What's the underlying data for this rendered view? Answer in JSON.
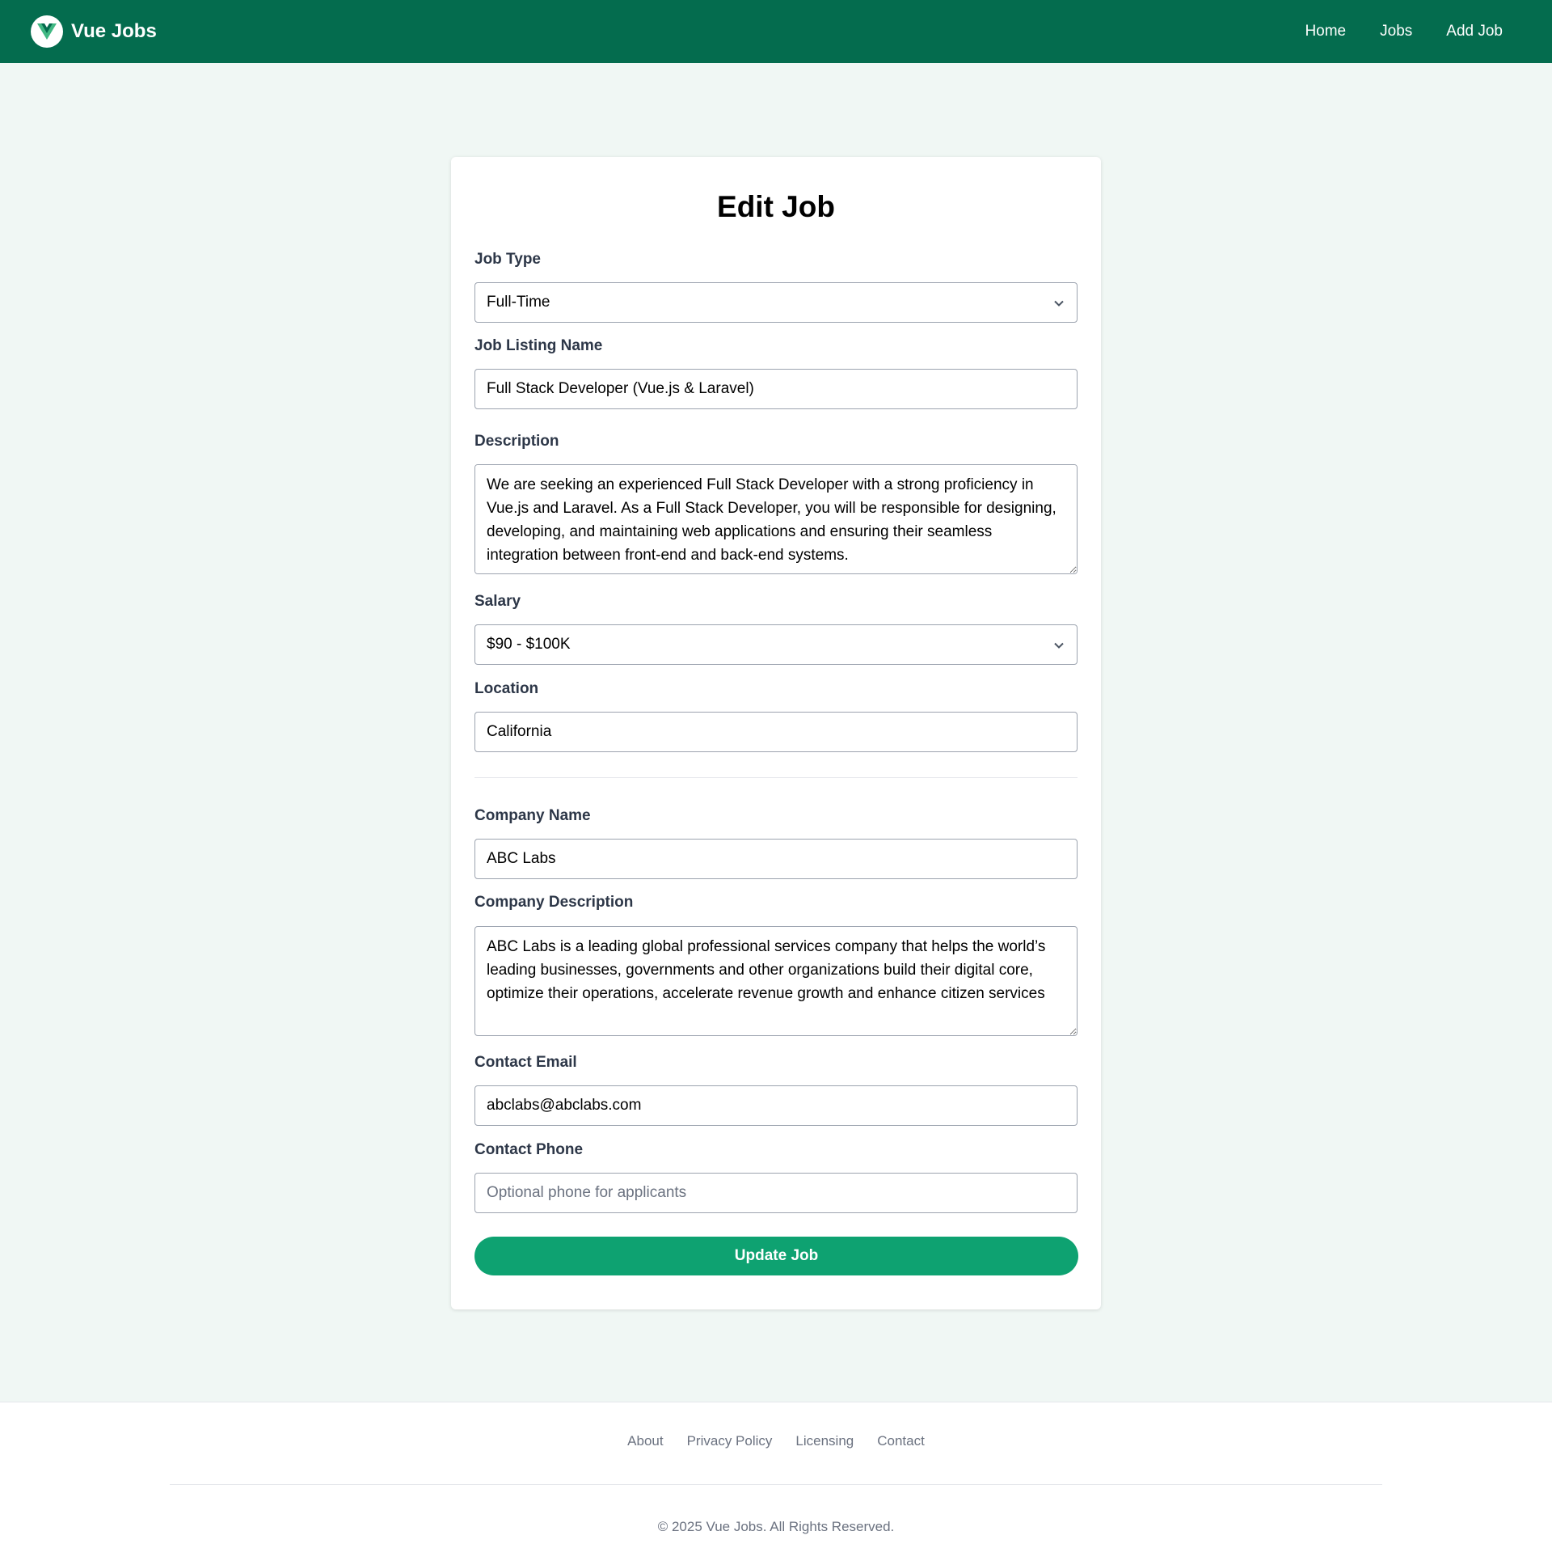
{
  "header": {
    "brand": "Vue Jobs",
    "nav": [
      "Home",
      "Jobs",
      "Add Job"
    ]
  },
  "form": {
    "title": "Edit Job",
    "job_type": {
      "label": "Job Type",
      "value": "Full-Time"
    },
    "job_name": {
      "label": "Job Listing Name",
      "value": "Full Stack Developer (Vue.js & Laravel)"
    },
    "description": {
      "label": "Description",
      "value": "We are seeking an experienced Full Stack Developer with a strong proficiency in Vue.js and Laravel. As a Full Stack Developer, you will be responsible for designing, developing, and maintaining web applications and ensuring their seamless integration between front-end and back-end systems."
    },
    "salary": {
      "label": "Salary",
      "value": "$90 - $100K"
    },
    "location": {
      "label": "Location",
      "value": "California"
    },
    "company_name": {
      "label": "Company Name",
      "value": "ABC Labs"
    },
    "company_description": {
      "label": "Company Description",
      "value": "ABC Labs is a leading global professional services company that helps the world’s leading businesses, governments and other organizations build their digital core, optimize their operations, accelerate revenue growth and enhance citizen services"
    },
    "contact_email": {
      "label": "Contact Email",
      "value": "abclabs@abclabs.com"
    },
    "contact_phone": {
      "label": "Contact Phone",
      "placeholder": "Optional phone for applicants",
      "value": ""
    },
    "submit": "Update Job"
  },
  "footer": {
    "links": [
      "About",
      "Privacy Policy",
      "Licensing",
      "Contact"
    ],
    "copyright": "© 2025 Vue Jobs. All Rights Reserved."
  },
  "colors": {
    "header_bg": "#046c4e",
    "button_bg": "#0ea271",
    "page_bg": "#f0f7f4"
  }
}
